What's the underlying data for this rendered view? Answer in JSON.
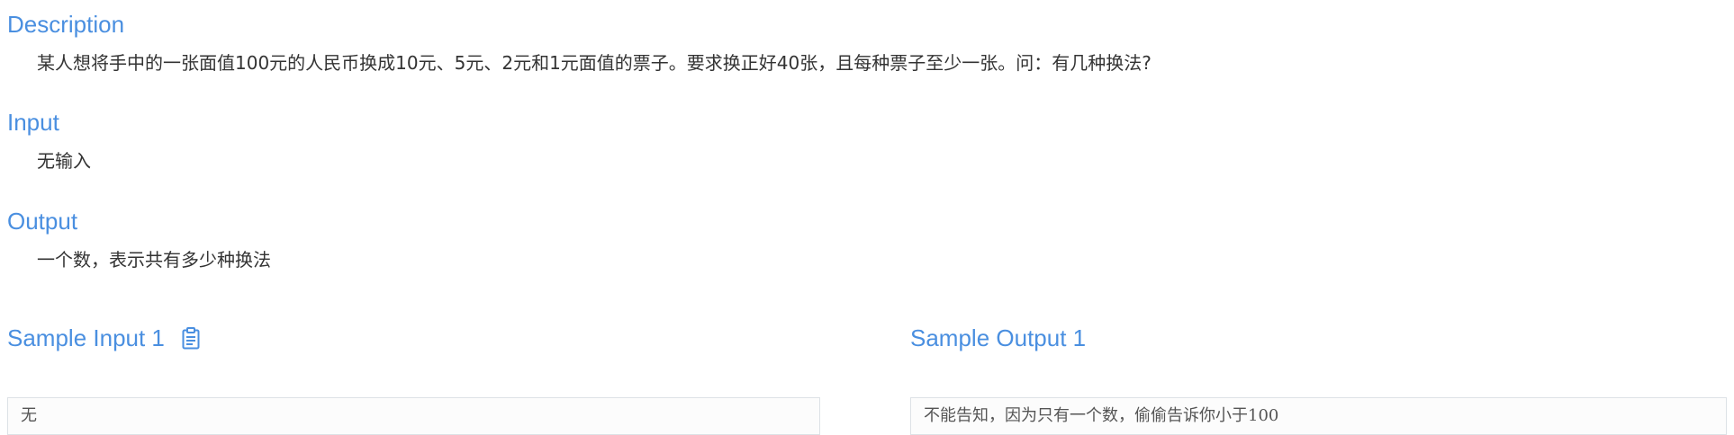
{
  "description": {
    "title": "Description",
    "text": "某人想将手中的一张面值100元的人民币换成10元、5元、2元和1元面值的票子。要求换正好40张，且每种票子至少一张。问：有几种换法?"
  },
  "input": {
    "title": "Input",
    "text": "无输入"
  },
  "output": {
    "title": "Output",
    "text": "一个数，表示共有多少种换法"
  },
  "sample_input": {
    "title": "Sample Input 1",
    "copy_icon": "clipboard-icon",
    "content": "无"
  },
  "sample_output": {
    "title": "Sample Output 1",
    "content": "不能告知，因为只有一个数，偷偷告诉你小于100"
  },
  "colors": {
    "heading": "#4a8fe0",
    "body_text": "#333333",
    "box_border": "#dde2e6",
    "box_background": "#fcfcfc"
  }
}
